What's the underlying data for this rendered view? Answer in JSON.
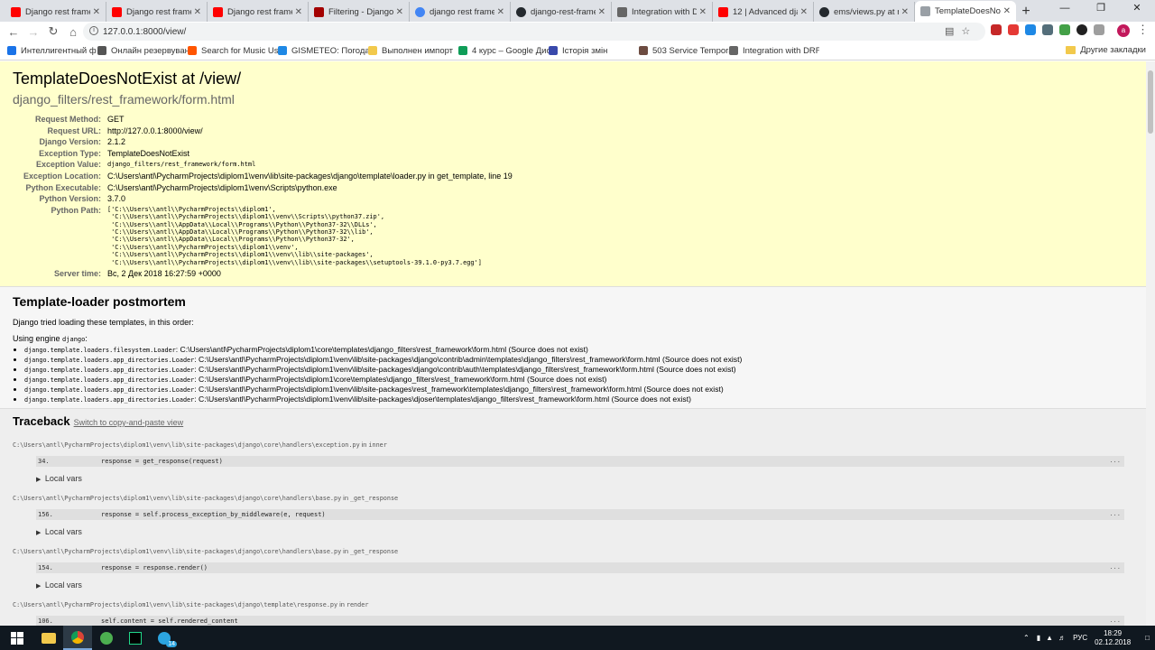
{
  "browser": {
    "tabs": [
      {
        "title": "Django rest framew",
        "icon": "youtube-icon",
        "color": "#ff0000"
      },
      {
        "title": "Django rest framew",
        "icon": "youtube-icon",
        "color": "#ff0000"
      },
      {
        "title": "Django rest framew",
        "icon": "youtube-icon",
        "color": "#ff0000"
      },
      {
        "title": "Filtering - Django R",
        "icon": "drf-icon",
        "color": "#a30000"
      },
      {
        "title": "django rest framew",
        "icon": "google-icon",
        "color": "#4285f4"
      },
      {
        "title": "django-rest-framew",
        "icon": "github-icon",
        "color": "#24292e"
      },
      {
        "title": "Integration with DR",
        "icon": "doc-icon",
        "color": "#666666"
      },
      {
        "title": "12 | Advanced djang",
        "icon": "youtube-icon",
        "color": "#ff0000"
      },
      {
        "title": "ems/views.py at ma",
        "icon": "github-icon",
        "color": "#24292e"
      },
      {
        "title": "TemplateDoesNotE",
        "icon": "page-icon",
        "color": "#9aa0a6"
      }
    ],
    "url": "127.0.0.1:8000/view/",
    "bookmarks": [
      {
        "label": "Интеллигентный ф",
        "color": "#1a73e8"
      },
      {
        "label": "Онлайн резервуван",
        "color": "#555555"
      },
      {
        "label": "Search for Music Usi",
        "color": "#ff5500"
      },
      {
        "label": "GISMETEO: Погода в",
        "color": "#1e88e5"
      },
      {
        "label": "Выполнен импорт",
        "color": "#f2c94c"
      },
      {
        "label": "4 курс – Google Дис",
        "color": "#0f9d58"
      },
      {
        "label": "Історія змін",
        "color": "#3949ab"
      },
      {
        "label": "503 Service Tempora",
        "color": "#6d4c41"
      },
      {
        "label": "Integration with DRF",
        "color": "#666666"
      }
    ],
    "other_bookmarks": "Другие закладки"
  },
  "summary": {
    "title": "TemplateDoesNotExist at /view/",
    "subtitle": "django_filters/rest_framework/form.html",
    "rows": [
      {
        "key": "Request Method:",
        "value": "GET"
      },
      {
        "key": "Request URL:",
        "value": "http://127.0.0.1:8000/view/"
      },
      {
        "key": "Django Version:",
        "value": "2.1.2"
      },
      {
        "key": "Exception Type:",
        "value": "TemplateDoesNotExist"
      },
      {
        "key": "Exception Value:",
        "value": "django_filters/rest_framework/form.html"
      },
      {
        "key": "Exception Location:",
        "value": "C:\\Users\\antl\\PycharmProjects\\diplom1\\venv\\lib\\site-packages\\django\\template\\loader.py in get_template, line 19"
      },
      {
        "key": "Python Executable:",
        "value": "C:\\Users\\antl\\PycharmProjects\\diplom1\\venv\\Scripts\\python.exe"
      },
      {
        "key": "Python Version:",
        "value": "3.7.0"
      }
    ],
    "python_path_label": "Python Path:",
    "python_path": "['C:\\\\Users\\\\antl\\\\PycharmProjects\\\\diplom1',\n 'C:\\\\Users\\\\antl\\\\PycharmProjects\\\\diplom1\\\\venv\\\\Scripts\\\\python37.zip',\n 'C:\\\\Users\\\\antl\\\\AppData\\\\Local\\\\Programs\\\\Python\\\\Python37-32\\\\DLLs',\n 'C:\\\\Users\\\\antl\\\\AppData\\\\Local\\\\Programs\\\\Python\\\\Python37-32\\\\lib',\n 'C:\\\\Users\\\\antl\\\\AppData\\\\Local\\\\Programs\\\\Python\\\\Python37-32',\n 'C:\\\\Users\\\\antl\\\\PycharmProjects\\\\diplom1\\\\venv',\n 'C:\\\\Users\\\\antl\\\\PycharmProjects\\\\diplom1\\\\venv\\\\lib\\\\site-packages',\n 'C:\\\\Users\\\\antl\\\\PycharmProjects\\\\diplom1\\\\venv\\\\lib\\\\site-packages\\\\setuptools-39.1.0-py3.7.egg']",
    "server_time_label": "Server time:",
    "server_time": "Вс, 2 Дек 2018 16:27:59 +0000"
  },
  "postmortem": {
    "title": "Template-loader postmortem",
    "intro": "Django tried loading these templates, in this order:",
    "engine_prefix": "Using engine ",
    "engine": "django",
    "engine_suffix": ":",
    "loaders": [
      {
        "loader": "django.template.loaders.filesystem.Loader",
        "path": ": C:\\Users\\antl\\PycharmProjects\\diplom1\\core\\templates\\django_filters\\rest_framework\\form.html (Source does not exist)"
      },
      {
        "loader": "django.template.loaders.app_directories.Loader",
        "path": ": C:\\Users\\antl\\PycharmProjects\\diplom1\\venv\\lib\\site-packages\\django\\contrib\\admin\\templates\\django_filters\\rest_framework\\form.html (Source does not exist)"
      },
      {
        "loader": "django.template.loaders.app_directories.Loader",
        "path": ": C:\\Users\\antl\\PycharmProjects\\diplom1\\venv\\lib\\site-packages\\django\\contrib\\auth\\templates\\django_filters\\rest_framework\\form.html (Source does not exist)"
      },
      {
        "loader": "django.template.loaders.app_directories.Loader",
        "path": ": C:\\Users\\antl\\PycharmProjects\\diplom1\\core\\templates\\django_filters\\rest_framework\\form.html (Source does not exist)"
      },
      {
        "loader": "django.template.loaders.app_directories.Loader",
        "path": ": C:\\Users\\antl\\PycharmProjects\\diplom1\\venv\\lib\\site-packages\\rest_framework\\templates\\django_filters\\rest_framework\\form.html (Source does not exist)"
      },
      {
        "loader": "django.template.loaders.app_directories.Loader",
        "path": ": C:\\Users\\antl\\PycharmProjects\\diplom1\\venv\\lib\\site-packages\\djoser\\templates\\django_filters\\rest_framework\\form.html (Source does not exist)"
      }
    ]
  },
  "traceback": {
    "title": "Traceback",
    "switch_link": "Switch to copy-and-paste view",
    "local_vars_label": "Local vars",
    "in_label": "in",
    "ellipsis": "...",
    "frames": [
      {
        "file": "C:\\Users\\antl\\PycharmProjects\\diplom1\\venv\\lib\\site-packages\\django\\core\\handlers\\exception.py",
        "func": "inner",
        "line": "34.",
        "code": "response = get_response(request)"
      },
      {
        "file": "C:\\Users\\antl\\PycharmProjects\\diplom1\\venv\\lib\\site-packages\\django\\core\\handlers\\base.py",
        "func": "_get_response",
        "line": "156.",
        "code": "response = self.process_exception_by_middleware(e, request)"
      },
      {
        "file": "C:\\Users\\antl\\PycharmProjects\\diplom1\\venv\\lib\\site-packages\\django\\core\\handlers\\base.py",
        "func": "_get_response",
        "line": "154.",
        "code": "response = response.render()"
      },
      {
        "file": "C:\\Users\\antl\\PycharmProjects\\diplom1\\venv\\lib\\site-packages\\django\\template\\response.py",
        "func": "render",
        "line": "106.",
        "code": "self.content = self.rendered_content"
      }
    ]
  },
  "taskbar": {
    "language": "РУС",
    "time": "18:29",
    "date": "02.12.2018",
    "badge": "14"
  }
}
